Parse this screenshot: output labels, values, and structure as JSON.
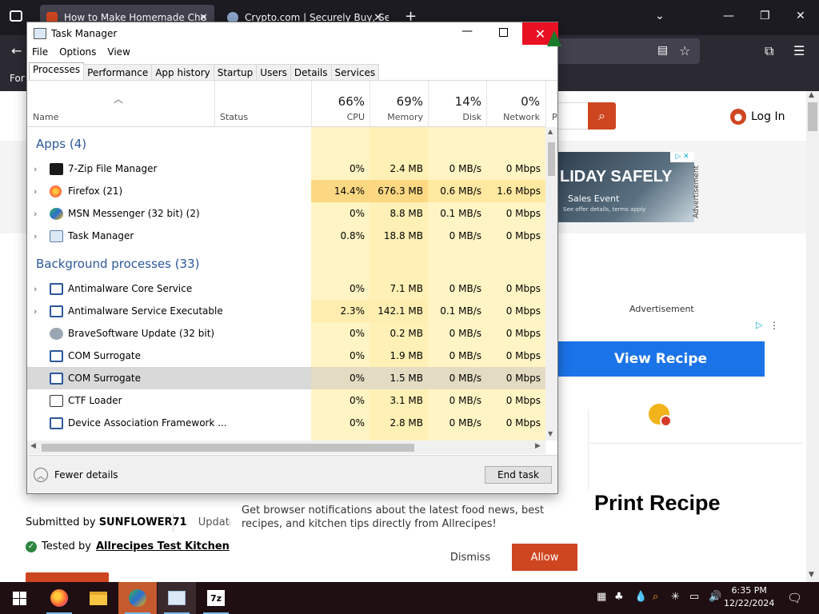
{
  "browser": {
    "tabs": [
      {
        "title": "How to Make Homemade Che",
        "active": true
      },
      {
        "title": "Crypto.com | Securely Buy, Sell",
        "active": false
      }
    ],
    "bookmark_text": "For"
  },
  "page": {
    "login_label": "Log In",
    "ad1": {
      "headline": "LIDAY SAFELY",
      "sub": "Sales Event",
      "fine": "See offer details, terms apply",
      "vertical_label": "Advertisement"
    },
    "ad2_label": "Advertisement",
    "view_recipe": "View Recipe",
    "print_recipe": "Print Recipe",
    "submitted_prefix": "Submitted by",
    "submitted_user": "SUNFLOWER71",
    "updated_prefix": "Updated or",
    "tested_prefix": "Tested by",
    "tested_link": "Allrecipes Test Kitchen",
    "notification": {
      "text": "Get browser notifications about the latest food news, best recipes, and kitchen tips directly from Allrecipes!",
      "dismiss": "Dismiss",
      "allow": "Allow"
    }
  },
  "task_manager": {
    "title": "Task Manager",
    "menu": [
      "File",
      "Options",
      "View"
    ],
    "tabs": [
      "Processes",
      "Performance",
      "App history",
      "Startup",
      "Users",
      "Details",
      "Services"
    ],
    "active_tab": "Processes",
    "columns": {
      "name": "Name",
      "status": "Status",
      "cpu": {
        "pct": "66%",
        "label": "CPU"
      },
      "memory": {
        "pct": "69%",
        "label": "Memory"
      },
      "disk": {
        "pct": "14%",
        "label": "Disk"
      },
      "network": {
        "pct": "0%",
        "label": "Network"
      },
      "power_peek": "P"
    },
    "groups": {
      "apps": "Apps (4)",
      "background": "Background processes (33)"
    },
    "apps": [
      {
        "name": "7-Zip File Manager",
        "cpu": "0%",
        "memory": "2.4 MB",
        "disk": "0 MB/s",
        "network": "0 Mbps",
        "icon": "7zip-icon"
      },
      {
        "name": "Firefox (21)",
        "cpu": "14.4%",
        "memory": "676.3 MB",
        "disk": "0.6 MB/s",
        "network": "1.6 Mbps",
        "icon": "firefox-icon"
      },
      {
        "name": "MSN Messenger (32 bit) (2)",
        "cpu": "0%",
        "memory": "8.8 MB",
        "disk": "0.1 MB/s",
        "network": "0 Mbps",
        "icon": "msn-icon"
      },
      {
        "name": "Task Manager",
        "cpu": "0.8%",
        "memory": "18.8 MB",
        "disk": "0 MB/s",
        "network": "0 Mbps",
        "icon": "task-manager-icon"
      }
    ],
    "background": [
      {
        "name": "Antimalware Core Service",
        "cpu": "0%",
        "memory": "7.1 MB",
        "disk": "0 MB/s",
        "network": "0 Mbps",
        "expandable": true
      },
      {
        "name": "Antimalware Service Executable",
        "cpu": "2.3%",
        "memory": "142.1 MB",
        "disk": "0.1 MB/s",
        "network": "0 Mbps",
        "expandable": true
      },
      {
        "name": "BraveSoftware Update (32 bit)",
        "cpu": "0%",
        "memory": "0.2 MB",
        "disk": "0 MB/s",
        "network": "0 Mbps",
        "expandable": false
      },
      {
        "name": "COM Surrogate",
        "cpu": "0%",
        "memory": "1.9 MB",
        "disk": "0 MB/s",
        "network": "0 Mbps",
        "expandable": false
      },
      {
        "name": "COM Surrogate",
        "cpu": "0%",
        "memory": "1.5 MB",
        "disk": "0 MB/s",
        "network": "0 Mbps",
        "expandable": false,
        "selected": true
      },
      {
        "name": "CTF Loader",
        "cpu": "0%",
        "memory": "3.1 MB",
        "disk": "0 MB/s",
        "network": "0 Mbps",
        "expandable": false
      },
      {
        "name": "Device Association Framework ...",
        "cpu": "0%",
        "memory": "2.8 MB",
        "disk": "0 MB/s",
        "network": "0 Mbps",
        "expandable": false
      }
    ],
    "fewer_details": "Fewer details",
    "end_task": "End task"
  },
  "taskbar": {
    "time": "6:35 PM",
    "date": "12/22/2024"
  },
  "colors": {
    "accent": "#ce4620",
    "tm_heat_light": "#fff4c4",
    "tm_heat_medium": "#ffe8a0",
    "tm_heat_strong": "#fcd883",
    "group_heading": "#2b579a",
    "close_red": "#e81123"
  }
}
